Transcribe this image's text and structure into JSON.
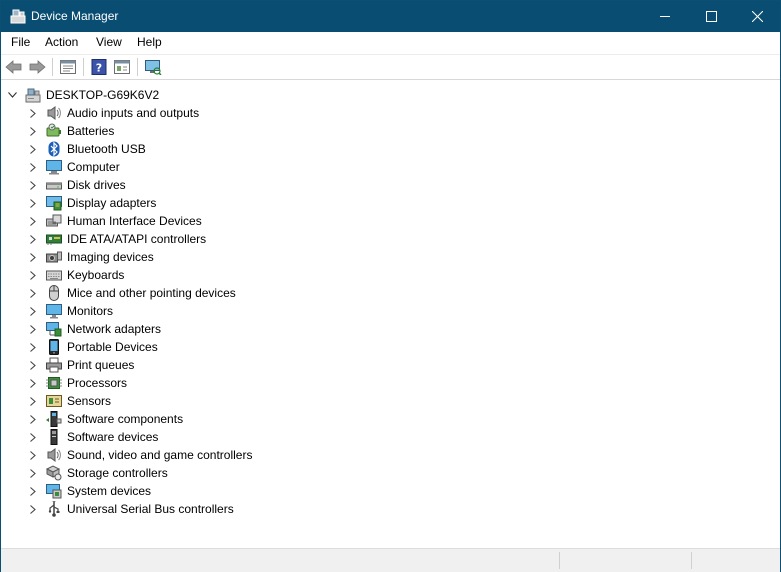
{
  "window": {
    "title": "Device Manager",
    "title_bar_color": "#0a4d72"
  },
  "menu": [
    "File",
    "Action",
    "View",
    "Help"
  ],
  "toolbar_icons": [
    "back-icon",
    "forward-icon",
    "properties-icon",
    "help-icon",
    "update-driver-icon",
    "scan-hardware-icon"
  ],
  "tree": {
    "root": "DESKTOP-G69K6V2",
    "categories": [
      {
        "label": "Audio inputs and outputs",
        "icon": "speaker-icon"
      },
      {
        "label": "Batteries",
        "icon": "battery-icon"
      },
      {
        "label": "Bluetooth USB",
        "icon": "bluetooth-icon"
      },
      {
        "label": "Computer",
        "icon": "computer-icon"
      },
      {
        "label": "Disk drives",
        "icon": "disk-drive-icon"
      },
      {
        "label": "Display adapters",
        "icon": "display-adapter-icon"
      },
      {
        "label": "Human Interface Devices",
        "icon": "hid-icon"
      },
      {
        "label": "IDE ATA/ATAPI controllers",
        "icon": "ide-controller-icon"
      },
      {
        "label": "Imaging devices",
        "icon": "camera-icon"
      },
      {
        "label": "Keyboards",
        "icon": "keyboard-icon"
      },
      {
        "label": "Mice and other pointing devices",
        "icon": "mouse-icon"
      },
      {
        "label": "Monitors",
        "icon": "monitor-icon"
      },
      {
        "label": "Network adapters",
        "icon": "network-icon"
      },
      {
        "label": "Portable Devices",
        "icon": "portable-device-icon"
      },
      {
        "label": "Print queues",
        "icon": "printer-icon"
      },
      {
        "label": "Processors",
        "icon": "processor-icon"
      },
      {
        "label": "Sensors",
        "icon": "sensor-icon"
      },
      {
        "label": "Software components",
        "icon": "software-component-icon"
      },
      {
        "label": "Software devices",
        "icon": "software-device-icon"
      },
      {
        "label": "Sound, video and game controllers",
        "icon": "sound-icon"
      },
      {
        "label": "Storage controllers",
        "icon": "storage-controller-icon"
      },
      {
        "label": "System devices",
        "icon": "system-device-icon"
      },
      {
        "label": "Universal Serial Bus controllers",
        "icon": "usb-icon"
      }
    ]
  }
}
